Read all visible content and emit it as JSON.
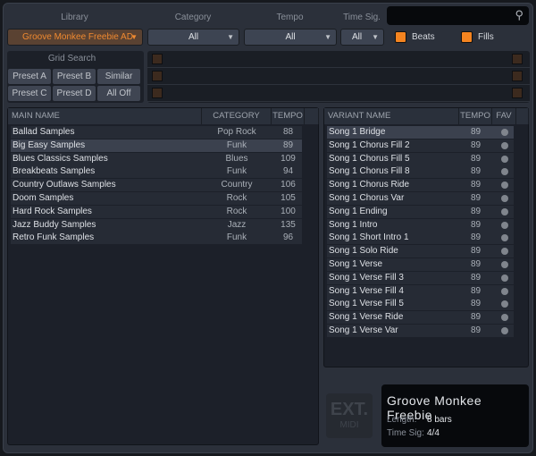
{
  "filters": {
    "library_label": "Library",
    "category_label": "Category",
    "tempo_label": "Tempo",
    "timesig_label": "Time Sig.",
    "library_value": "Groove Monkee Freebie AD",
    "category_value": "All",
    "tempo_value": "All",
    "timesig_value": "All",
    "beats_label": "Beats",
    "fills_label": "Fills",
    "beats_checked": true,
    "fills_checked": true,
    "search_value": ""
  },
  "grid": {
    "title": "Grid Search",
    "buttons": [
      "Preset A",
      "Preset B",
      "Similar",
      "Preset C",
      "Preset D",
      "All Off"
    ]
  },
  "main_table": {
    "headers": [
      "MAIN NAME",
      "CATEGORY",
      "TEMPO"
    ],
    "rows": [
      [
        "Ballad Samples",
        "Pop Rock",
        "88"
      ],
      [
        "Big Easy Samples",
        "Funk",
        "89"
      ],
      [
        "Blues Classics Samples",
        "Blues",
        "109"
      ],
      [
        "Breakbeats Samples",
        "Funk",
        "94"
      ],
      [
        "Country Outlaws Samples",
        "Country",
        "106"
      ],
      [
        "Doom Samples",
        "Rock",
        "105"
      ],
      [
        "Hard Rock Samples",
        "Rock",
        "100"
      ],
      [
        "Jazz Buddy Samples",
        "Jazz",
        "135"
      ],
      [
        "Retro Funk Samples",
        "Funk",
        "96"
      ]
    ],
    "selected": 1
  },
  "variant_table": {
    "headers": [
      "VARIANT NAME",
      "TEMPO",
      "FAV"
    ],
    "rows": [
      [
        "Song 1 Bridge",
        "89"
      ],
      [
        "Song 1 Chorus Fill 2",
        "89"
      ],
      [
        "Song 1 Chorus Fill 5",
        "89"
      ],
      [
        "Song 1 Chorus Fill 8",
        "89"
      ],
      [
        "Song 1 Chorus Ride",
        "89"
      ],
      [
        "Song 1 Chorus Var",
        "89"
      ],
      [
        "Song 1 Ending",
        "89"
      ],
      [
        "Song 1 Intro",
        "89"
      ],
      [
        "Song 1 Short Intro 1",
        "89"
      ],
      [
        "Song 1 Solo Ride",
        "89"
      ],
      [
        "Song 1 Verse",
        "89"
      ],
      [
        "Song 1 Verse Fill 3",
        "89"
      ],
      [
        "Song 1 Verse Fill 4",
        "89"
      ],
      [
        "Song 1 Verse Fill 5",
        "89"
      ],
      [
        "Song 1 Verse Ride",
        "89"
      ],
      [
        "Song 1 Verse Var",
        "89"
      ]
    ],
    "selected": 0
  },
  "ext_midi": {
    "big": "EXT.",
    "small": "MIDI"
  },
  "info": {
    "title": "Groove Monkee Freebie",
    "length_label": "Length:",
    "length_value": "8 bars",
    "timesig_label": "Time Sig:",
    "timesig_value": "4/4"
  },
  "colors": {
    "accent": "#f48420"
  }
}
